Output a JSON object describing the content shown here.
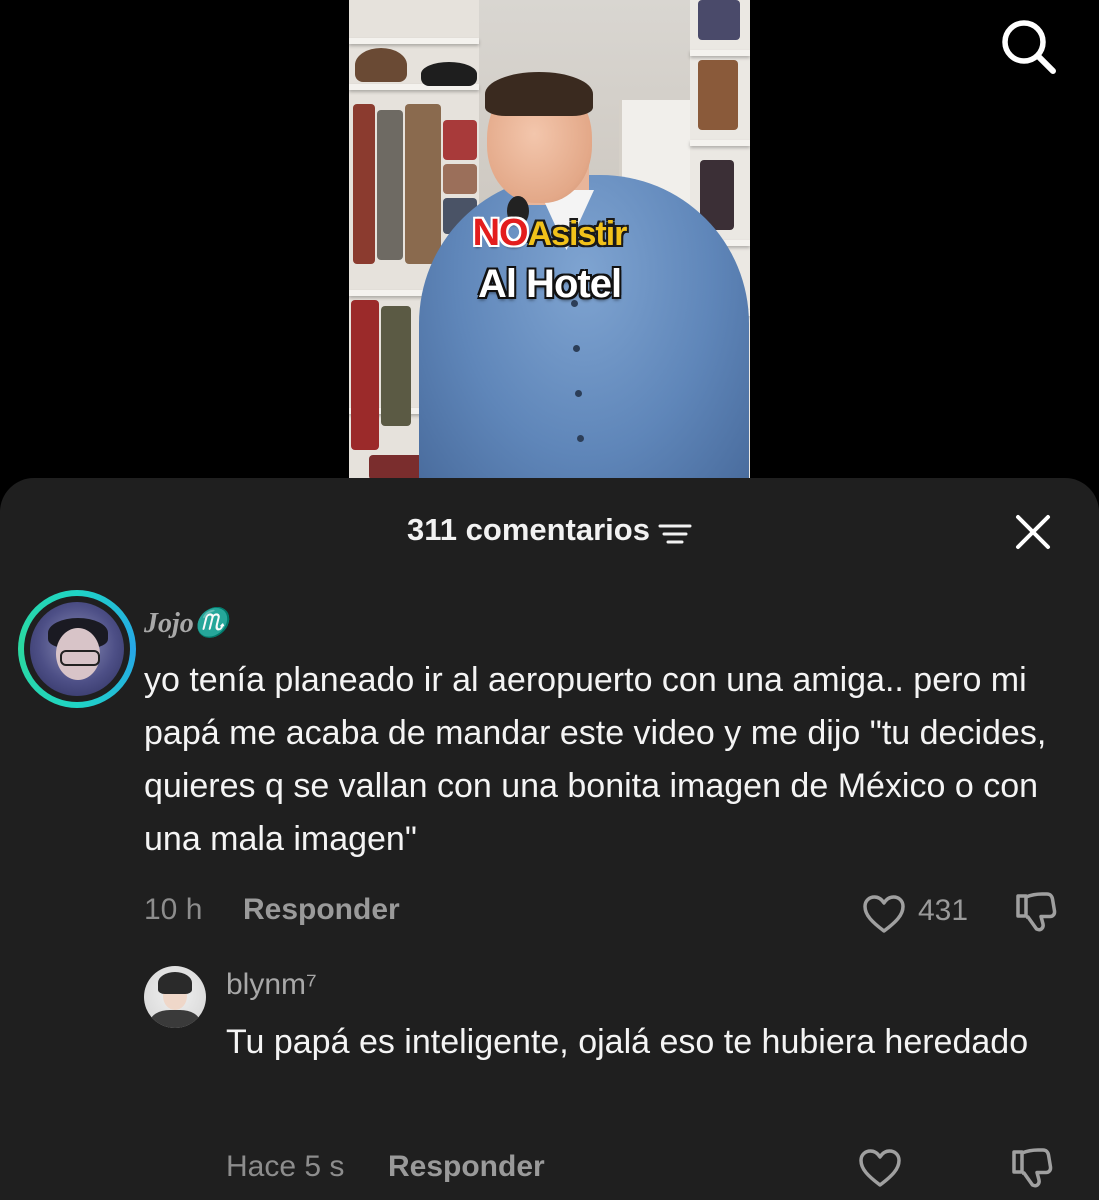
{
  "video": {
    "overlay_line1_word1": "NO",
    "overlay_line1_word2": "Asistir",
    "overlay_line2": "Al Hotel"
  },
  "sheet": {
    "title": "311 comentarios"
  },
  "comments": [
    {
      "username": "Jojo♏",
      "text": "yo tenía planeado ir al aeropuerto con una amiga.. pero mi papá me acaba de mandar este video y me dijo \"tu decides, quieres q se vallan con una bonita imagen de México o con una mala imagen\"",
      "time": "10 h",
      "reply_label": "Responder",
      "likes": "431"
    },
    {
      "username": "blynm⁷",
      "text": "Tu papá es inteligente, ojalá eso te hubiera heredado",
      "time": "Hace 5 s",
      "reply_label": "Responder"
    }
  ],
  "colors": {
    "sheet_bg": "#1f1f1f",
    "avatar_ring": "#1fd4c5",
    "overlay_red": "#e31d1d",
    "overlay_yellow": "#f2c21a"
  },
  "icons": {
    "search": "search-icon",
    "sort": "sort-icon",
    "close": "close-icon",
    "like": "heart-icon",
    "dislike": "thumbs-down-icon"
  }
}
